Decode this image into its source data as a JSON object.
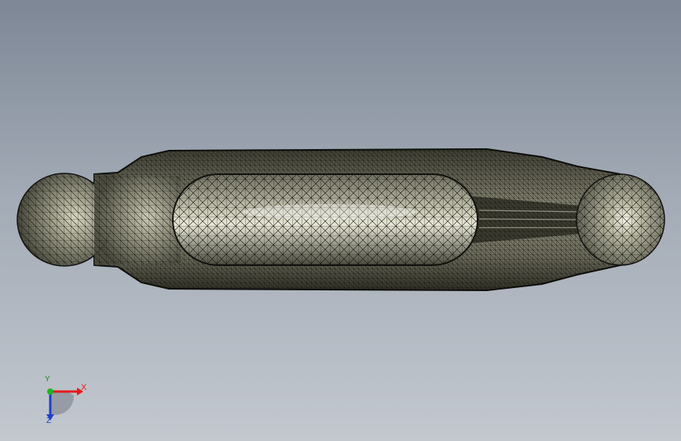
{
  "viewport": {
    "background_top": "#7d8796",
    "background_bottom": "#c3c8cf",
    "view": "top"
  },
  "model": {
    "name": "mesh-part",
    "display_mode": "shaded-with-mesh-edges",
    "surface_color": "#9b9a86",
    "edge_color": "#1a1a16"
  },
  "triad": {
    "x_label": "X",
    "y_label": "Y",
    "z_label": "Z",
    "x_color": "#e31b1b",
    "y_color": "#1a8a1a",
    "z_color": "#1f3fcc"
  }
}
